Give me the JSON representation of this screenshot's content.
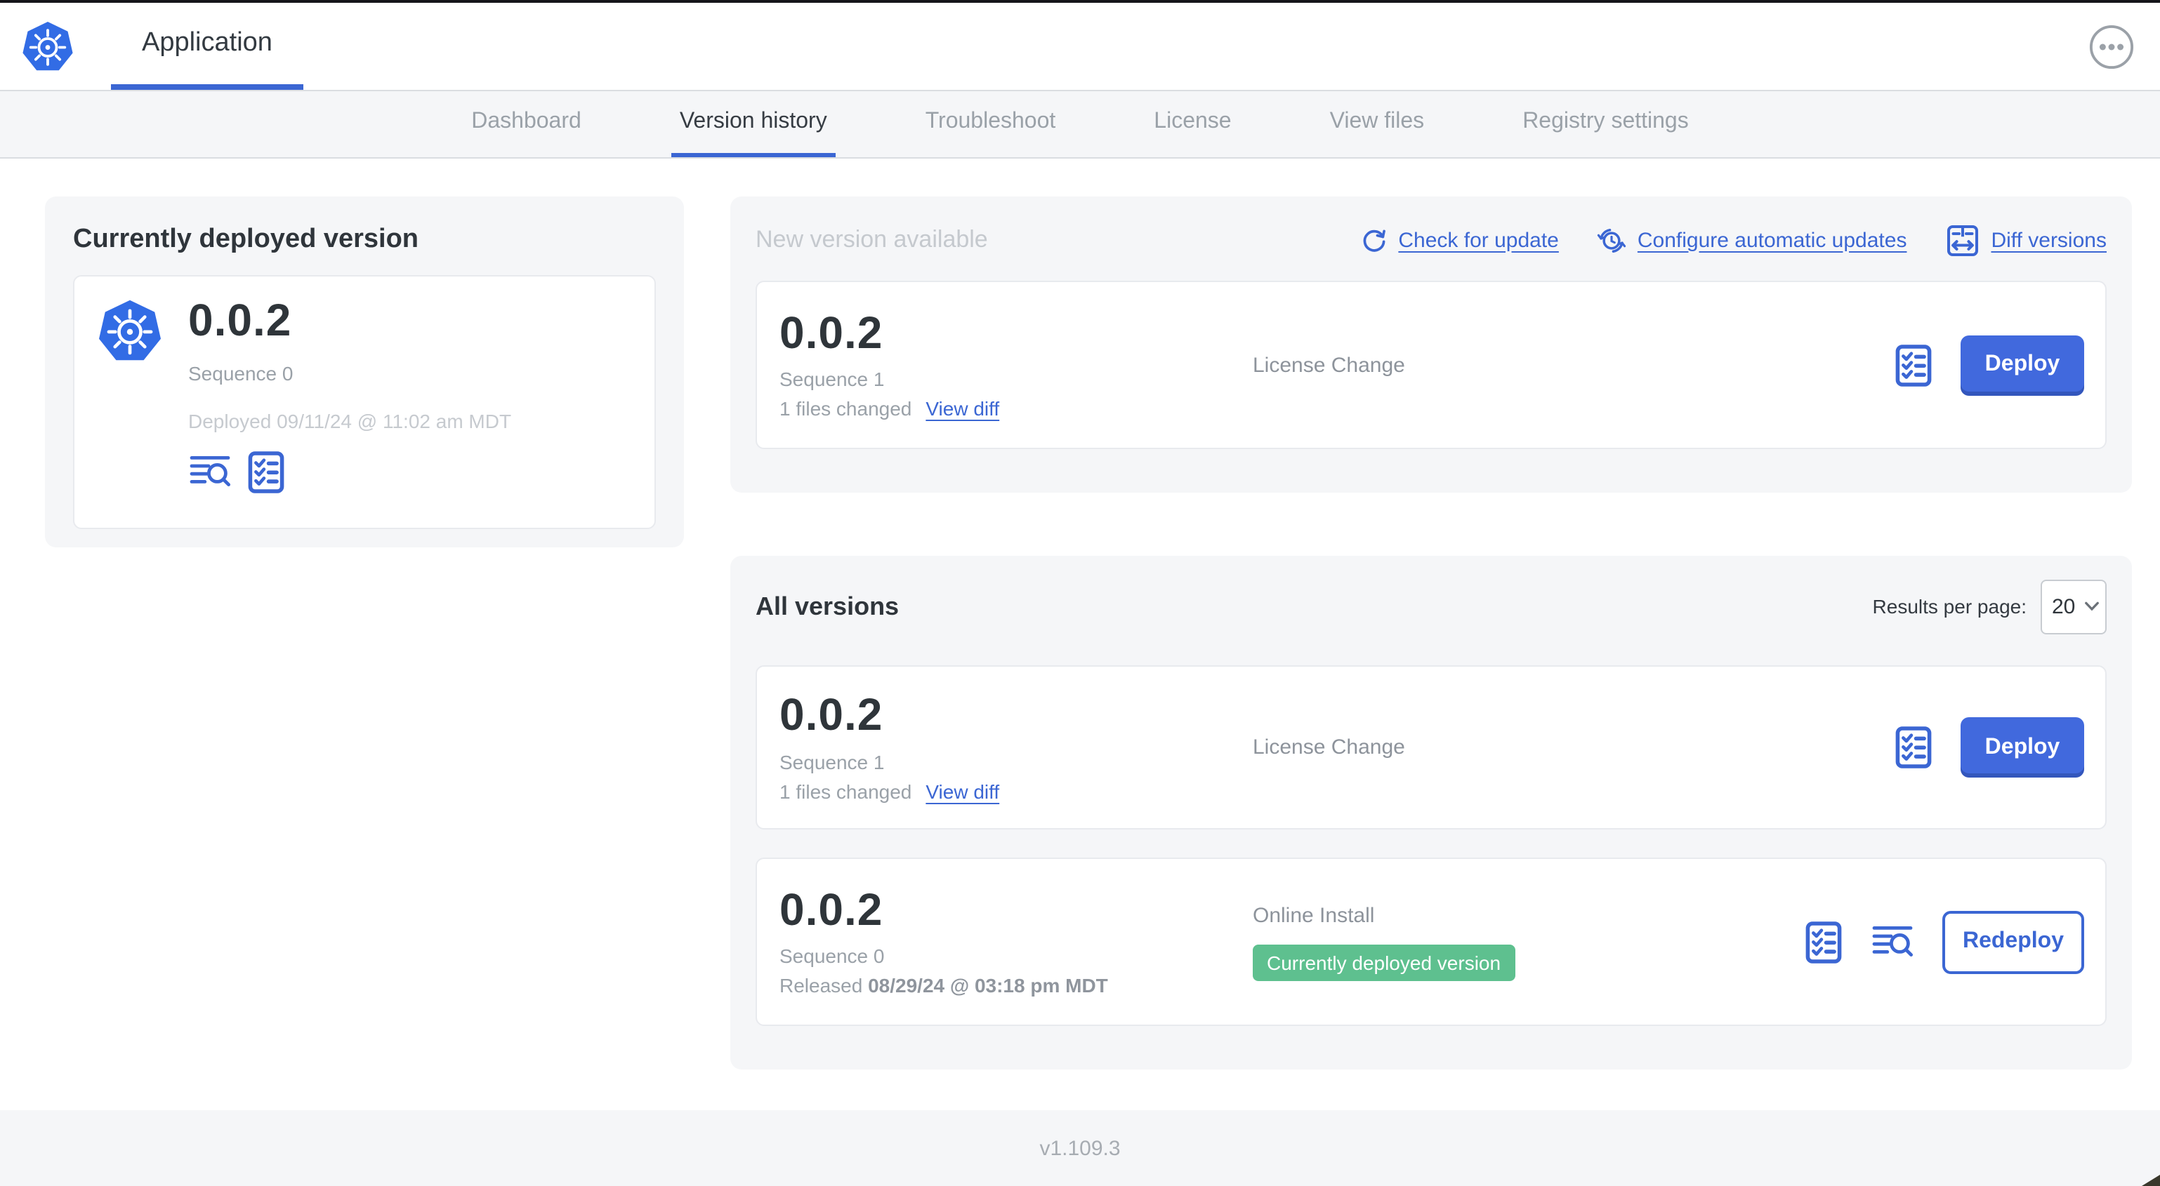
{
  "app": {
    "title": "Application",
    "console_version": "v1.109.3"
  },
  "nav": {
    "tabs": [
      {
        "label": "Dashboard"
      },
      {
        "label": "Version history"
      },
      {
        "label": "Troubleshoot"
      },
      {
        "label": "License"
      },
      {
        "label": "View files"
      },
      {
        "label": "Registry settings"
      }
    ]
  },
  "current_version": {
    "title": "Currently deployed version",
    "version": "0.0.2",
    "sequence": "Sequence 0",
    "deployed": "Deployed 09/11/24 @ 11:02 am MDT"
  },
  "new_version": {
    "title": "New version available",
    "actions": {
      "check_for_update": "Check for update",
      "configure_updates": "Configure automatic updates",
      "diff_versions": "Diff versions"
    },
    "row": {
      "version": "0.0.2",
      "sequence": "Sequence 1",
      "changes": "1 files changed",
      "view_diff": "View diff",
      "source": "License Change",
      "action": "Deploy"
    }
  },
  "all_versions": {
    "title": "All versions",
    "results_per_page_label": "Results per page:",
    "results_per_page": "20",
    "rows": [
      {
        "version": "0.0.2",
        "sequence": "Sequence 1",
        "changes": "1 files changed",
        "view_diff": "View diff",
        "source": "License Change",
        "action": "Deploy"
      },
      {
        "version": "0.0.2",
        "sequence": "Sequence 0",
        "released_label": "Released",
        "released_date": "08/29/24 @ 03:18 pm MDT",
        "source": "Online Install",
        "badge": "Currently deployed version",
        "action": "Redeploy"
      }
    ]
  },
  "colors": {
    "accent_blue": "#3b66d3",
    "kubernetes_blue": "#326ce5",
    "badge_green": "#5ec08f"
  }
}
